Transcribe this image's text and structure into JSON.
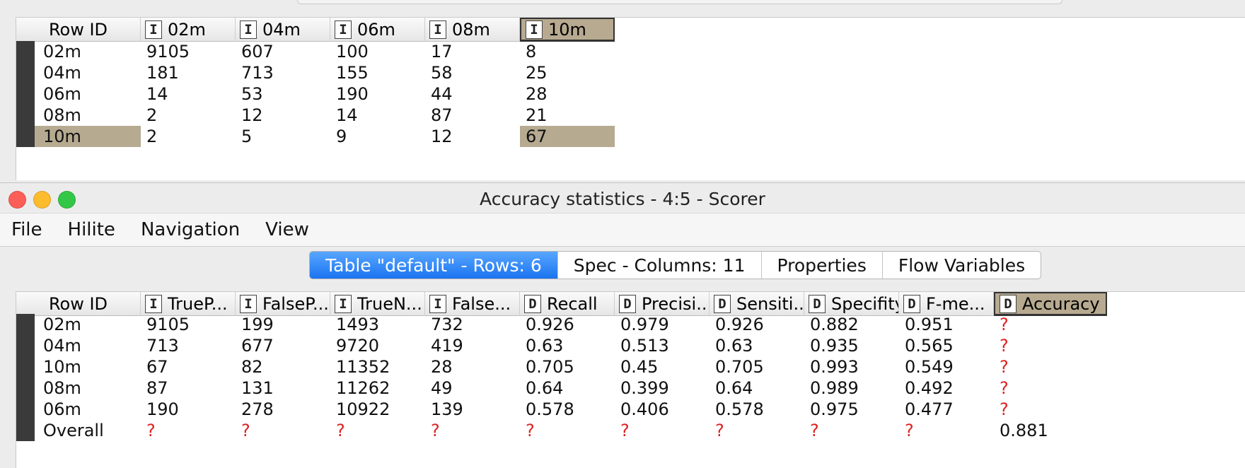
{
  "top_table": {
    "headers": [
      {
        "label": "Row ID",
        "type": ""
      },
      {
        "label": "02m",
        "type": "I"
      },
      {
        "label": "04m",
        "type": "I"
      },
      {
        "label": "06m",
        "type": "I"
      },
      {
        "label": "08m",
        "type": "I"
      },
      {
        "label": "10m",
        "type": "I"
      }
    ],
    "rows": [
      [
        "02m",
        "9105",
        "607",
        "100",
        "17",
        "8"
      ],
      [
        "04m",
        "181",
        "713",
        "155",
        "58",
        "25"
      ],
      [
        "06m",
        "14",
        "53",
        "190",
        "44",
        "28"
      ],
      [
        "08m",
        "2",
        "12",
        "14",
        "87",
        "21"
      ],
      [
        "10m",
        "2",
        "5",
        "9",
        "12",
        "67"
      ]
    ],
    "selected_row": "10m",
    "selected_column": "10m",
    "highlight_color": "#b6aa91"
  },
  "window": {
    "title": "Accuracy statistics - 4:5 - Scorer",
    "traffic_lights": [
      "#fc5f57",
      "#fdbc2e",
      "#33c748"
    ]
  },
  "menu": {
    "items": [
      "File",
      "Hilite",
      "Navigation",
      "View"
    ]
  },
  "tabs": [
    {
      "label": "Table \"default\" - Rows: 6",
      "active": true
    },
    {
      "label": "Spec - Columns: 11",
      "active": false
    },
    {
      "label": "Properties",
      "active": false
    },
    {
      "label": "Flow Variables",
      "active": false
    }
  ],
  "stats_table": {
    "headers": [
      {
        "label": "Row ID",
        "type": ""
      },
      {
        "label": "TrueP...",
        "type": "I"
      },
      {
        "label": "FalseP...",
        "type": "I"
      },
      {
        "label": "TrueN...",
        "type": "I"
      },
      {
        "label": "False...",
        "type": "I"
      },
      {
        "label": "Recall",
        "type": "D"
      },
      {
        "label": "Precisi...",
        "type": "D"
      },
      {
        "label": "Sensiti...",
        "type": "D"
      },
      {
        "label": "Specifity",
        "type": "D"
      },
      {
        "label": "F-me...",
        "type": "D"
      },
      {
        "label": "Accuracy",
        "type": "D"
      }
    ],
    "rows": [
      [
        "02m",
        "9105",
        "199",
        "1493",
        "732",
        "0.926",
        "0.979",
        "0.926",
        "0.882",
        "0.951",
        "?"
      ],
      [
        "04m",
        "713",
        "677",
        "9720",
        "419",
        "0.63",
        "0.513",
        "0.63",
        "0.935",
        "0.565",
        "?"
      ],
      [
        "10m",
        "67",
        "82",
        "11352",
        "28",
        "0.705",
        "0.45",
        "0.705",
        "0.993",
        "0.549",
        "?"
      ],
      [
        "08m",
        "87",
        "131",
        "11262",
        "49",
        "0.64",
        "0.399",
        "0.64",
        "0.989",
        "0.492",
        "?"
      ],
      [
        "06m",
        "190",
        "278",
        "10922",
        "139",
        "0.578",
        "0.406",
        "0.578",
        "0.975",
        "0.477",
        "?"
      ],
      [
        "Overall",
        "?",
        "?",
        "?",
        "?",
        "?",
        "?",
        "?",
        "?",
        "?",
        "0.881"
      ]
    ],
    "selected_column": "Accuracy",
    "missing_value_color": "#e02020"
  }
}
